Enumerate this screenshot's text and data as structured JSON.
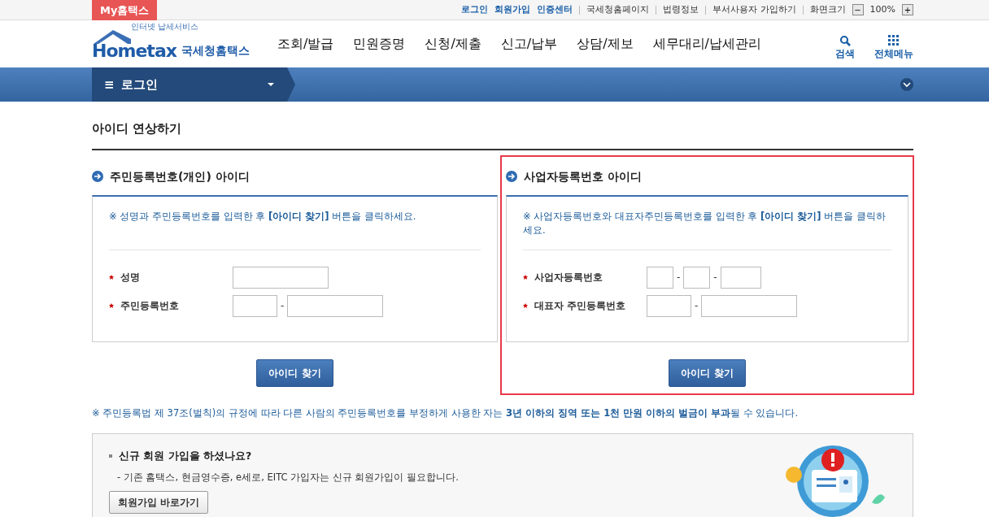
{
  "top_bar": {
    "my_button": "My홈택스",
    "links": [
      {
        "label": "로그인",
        "kind": "primary"
      },
      {
        "label": "회원가입",
        "kind": "primary"
      },
      {
        "label": "인증센터",
        "kind": "primary"
      },
      {
        "label": "국세청홈페이지",
        "kind": "plain"
      },
      {
        "label": "법령정보",
        "kind": "plain"
      },
      {
        "label": "부서사용자 가입하기",
        "kind": "plain"
      }
    ],
    "zoom_label": "화면크기",
    "zoom_out": "−",
    "zoom_value": "100%",
    "zoom_in": "+"
  },
  "header": {
    "logo_tagline": "인터넷 납세서비스",
    "logo_text": "Hometax",
    "logo_korean": "국세청홈택스",
    "menu": [
      "조회/발급",
      "민원증명",
      "신청/제출",
      "신고/납부",
      "상담/제보",
      "세무대리/납세관리"
    ],
    "tools": [
      {
        "label": "검색",
        "kind": "search"
      },
      {
        "label": "전체메뉴",
        "kind": "grid"
      }
    ]
  },
  "breadcrumb": {
    "menu_icon": "≡",
    "label": "로그인"
  },
  "page_title": "아이디 연상하기",
  "panels": [
    {
      "title": "주민등록번호(개인) 아이디",
      "highlighted": false,
      "note": "※ 성명과 주민등록번호를 입력한 후 **[아이디 찾기]** 버튼을 클릭하세요.",
      "fields": [
        {
          "label": "성명",
          "inputs": [
            {
              "kind": "medium"
            }
          ]
        },
        {
          "label": "주민등록번호",
          "inputs": [
            {
              "kind": "short"
            },
            {
              "kind": "long",
              "separator": "-"
            }
          ]
        }
      ],
      "button": "아이디 찾기"
    },
    {
      "title": "사업자등록번호 아이디",
      "highlighted": true,
      "note": "※ 사업자등록번호와 대표자주민등록번호를 입력한 후 **[아이디 찾기]**  버튼을 클릭하세요.",
      "fields": [
        {
          "label": "사업자등록번호",
          "inputs": [
            {
              "kind": "tiny"
            },
            {
              "kind": "tiny",
              "separator": "-"
            },
            {
              "kind": "small",
              "separator": "-"
            }
          ]
        },
        {
          "label": "대표자 주민등록번호",
          "inputs": [
            {
              "kind": "short"
            },
            {
              "kind": "long",
              "separator": "-"
            }
          ]
        }
      ],
      "button": "아이디 찾기"
    }
  ],
  "warning": "※ 주민등록법 제 37조(벌칙)의 규정에 따라 다른 사람의 주민등록번호를 부정하게 사용한 자는 **3년 이하의 징역 또는 1천 만원 이하의 벌금이 부과**될 수 있습니다.",
  "signup": {
    "title": "신규 회원 가입을 하셨나요?",
    "description": "- 기존 홈택스, 현금영수증, e세로, EITC 가입자는 신규 회원가입이 필요합니다.",
    "button": "회원가입 바로가기"
  }
}
